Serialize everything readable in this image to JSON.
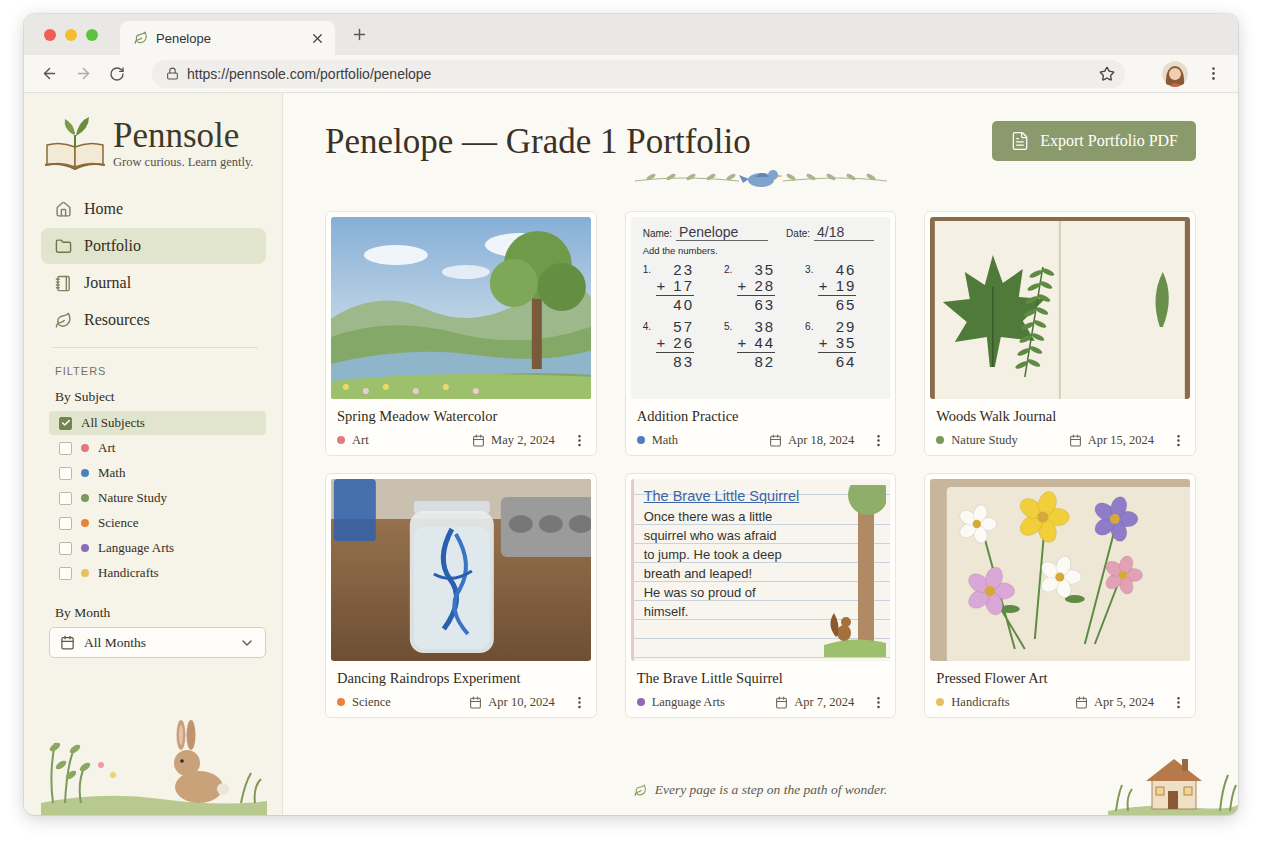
{
  "browser": {
    "tab": {
      "title": "Penelope"
    },
    "url": "https://pennsole.com/portfolio/penelope"
  },
  "sidebar": {
    "logo": {
      "name": "Pennsole",
      "tagline": "Grow curious. Learn gently."
    },
    "nav": [
      {
        "label": "Home",
        "selected": false
      },
      {
        "label": "Portfolio",
        "selected": true
      },
      {
        "label": "Journal",
        "selected": false
      },
      {
        "label": "Resources",
        "selected": false
      }
    ],
    "filters": {
      "heading": "FILTERS",
      "subject_heading": "By Subject",
      "subjects": [
        {
          "label": "All Subjects",
          "checked": true
        },
        {
          "label": "Art",
          "checked": false,
          "color": "#e07b7b"
        },
        {
          "label": "Math",
          "checked": false,
          "color": "#4f7fc2"
        },
        {
          "label": "Nature Study",
          "checked": false,
          "color": "#7b9a5a"
        },
        {
          "label": "Science",
          "checked": false,
          "color": "#e8843a"
        },
        {
          "label": "Language Arts",
          "checked": false,
          "color": "#8e6bb8"
        },
        {
          "label": "Handicrafts",
          "checked": false,
          "color": "#e8c062"
        }
      ],
      "month_heading": "By Month",
      "month": "All Months"
    }
  },
  "main": {
    "title": "Penelope — Grade 1 Portfolio",
    "export_button": "Export Portfolio PDF",
    "cards": [
      {
        "title": "Spring Meadow Watercolor",
        "subject": "Art",
        "color": "#e07b7b",
        "date": "May 2, 2024",
        "kind": "painting"
      },
      {
        "title": "Addition Practice",
        "subject": "Math",
        "color": "#4f7fc2",
        "date": "Apr 18, 2024",
        "kind": "worksheet",
        "worksheet": {
          "name_label": "Name:",
          "name": "Penelope",
          "date_label": "Date:",
          "date": "4/18",
          "instructions": "Add the numbers.",
          "problems": [
            {
              "number": "1.",
              "top": "23",
              "operator": "+",
              "bottom": "17",
              "answer": "40"
            },
            {
              "number": "2.",
              "top": "35",
              "operator": "+",
              "bottom": "28",
              "answer": "63"
            },
            {
              "number": "3.",
              "top": "46",
              "operator": "+",
              "bottom": "19",
              "answer": "65"
            },
            {
              "number": "4.",
              "top": "57",
              "operator": "+",
              "bottom": "26",
              "answer": "83"
            },
            {
              "number": "5.",
              "top": "38",
              "operator": "+",
              "bottom": "44",
              "answer": "82"
            },
            {
              "number": "6.",
              "top": "29",
              "operator": "+",
              "bottom": "35",
              "answer": "64"
            }
          ]
        }
      },
      {
        "title": "Woods Walk Journal",
        "subject": "Nature Study",
        "color": "#7b9a5a",
        "date": "Apr 15, 2024",
        "kind": "notebook"
      },
      {
        "title": "Dancing Raindrops Experiment",
        "subject": "Science",
        "color": "#e8843a",
        "date": "Apr 10, 2024",
        "kind": "experiment"
      },
      {
        "title": "The Brave Little Squirrel",
        "subject": "Language Arts",
        "color": "#8e6bb8",
        "date": "Apr 7, 2024",
        "kind": "story",
        "story": {
          "heading": "The Brave Little Squirrel",
          "lines": [
            "Once there was a little",
            "squirrel who was afraid",
            "to jump. He took a deep",
            "breath and leaped!",
            "He was so proud of",
            "himself."
          ]
        }
      },
      {
        "title": "Pressed Flower Art",
        "subject": "Handicrafts",
        "color": "#e8c062",
        "date": "Apr 5, 2024",
        "kind": "flowers"
      }
    ],
    "footer": "Every page is a step on the path of wonder."
  }
}
